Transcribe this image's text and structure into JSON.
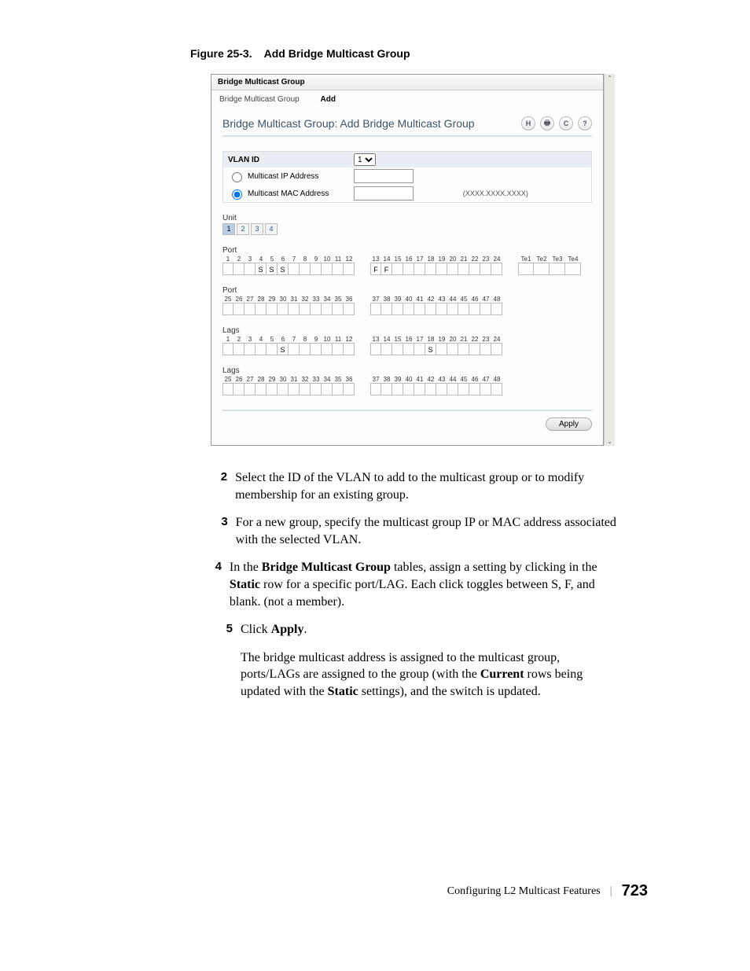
{
  "figure": {
    "label": "Figure 25-3.",
    "title": "Add Bridge Multicast Group"
  },
  "screenshot": {
    "topTab": "Bridge Multicast Group",
    "breadcrumb": {
      "a": "Bridge Multicast Group",
      "b": "Add"
    },
    "pageTitle": "Bridge Multicast Group: Add Bridge Multicast Group",
    "icons": {
      "save": "H",
      "print": "🖶",
      "refresh": "C",
      "help": "?"
    },
    "form": {
      "vlanLabel": "VLAN ID",
      "vlanValue": "1",
      "ipLabel": "Multicast IP Address",
      "macLabel": "Multicast MAC Address",
      "macHint": "(XXXX.XXXX.XXXX)"
    },
    "unit": {
      "label": "Unit",
      "items": [
        "1",
        "2",
        "3",
        "4"
      ]
    },
    "portLabel": "Port",
    "lagsLabel": "Lags",
    "portRow1a": [
      "1",
      "2",
      "3",
      "4",
      "5",
      "6",
      "7",
      "8",
      "9",
      "10",
      "11",
      "12"
    ],
    "portVals1a": [
      "",
      "",
      "",
      "S",
      "S",
      "S",
      "",
      "",
      "",
      "",
      "",
      ""
    ],
    "portRow1b": [
      "13",
      "14",
      "15",
      "16",
      "17",
      "18",
      "19",
      "20",
      "21",
      "22",
      "23",
      "24"
    ],
    "portVals1b": [
      "F",
      "F",
      "",
      "",
      "",
      "",
      "",
      "",
      "",
      "",
      "",
      ""
    ],
    "teHeader": [
      "Te1",
      "Te2",
      "Te3",
      "Te4"
    ],
    "teVals": [
      "",
      "",
      "",
      ""
    ],
    "portRow2a": [
      "25",
      "26",
      "27",
      "28",
      "29",
      "30",
      "31",
      "32",
      "33",
      "34",
      "35",
      "36"
    ],
    "portRow2b": [
      "37",
      "38",
      "39",
      "40",
      "41",
      "42",
      "43",
      "44",
      "45",
      "46",
      "47",
      "48"
    ],
    "lagRow1a": [
      "1",
      "2",
      "3",
      "4",
      "5",
      "6",
      "7",
      "8",
      "9",
      "10",
      "11",
      "12"
    ],
    "lagVals1a": [
      "",
      "",
      "",
      "",
      "",
      "S",
      "",
      "",
      "",
      "",
      "",
      ""
    ],
    "lagRow1b": [
      "13",
      "14",
      "15",
      "16",
      "17",
      "18",
      "19",
      "20",
      "21",
      "22",
      "23",
      "24"
    ],
    "lagVals1b": [
      "",
      "",
      "",
      "",
      "",
      "S",
      "",
      "",
      "",
      "",
      "",
      ""
    ],
    "lagRow2a": [
      "25",
      "26",
      "27",
      "28",
      "29",
      "30",
      "31",
      "32",
      "33",
      "34",
      "35",
      "36"
    ],
    "lagRow2b": [
      "37",
      "38",
      "39",
      "40",
      "41",
      "42",
      "43",
      "44",
      "45",
      "46",
      "47",
      "48"
    ],
    "applyLabel": "Apply"
  },
  "steps": {
    "s2": "Select the ID of the VLAN to add to the multicast group or to modify membership for an existing group.",
    "s3": "For a new group, specify the multicast group IP or MAC address associated with the selected VLAN.",
    "s4a": "In the ",
    "s4b": "Bridge Multicast Group",
    "s4c": " tables, assign a setting by clicking in the ",
    "s4d": "Static",
    "s4e": " row for a specific port/LAG. Each click toggles between S, F, and blank. (not a member).",
    "s5a": "Click ",
    "s5b": "Apply",
    "s5c": ".",
    "p1a": "The bridge multicast address is assigned to the multicast group, ports/LAGs are assigned to the group (with the ",
    "p1b": "Current",
    "p1c": " rows being updated with the ",
    "p1d": "Static",
    "p1e": " settings), and the switch is updated."
  },
  "footer": {
    "section": "Configuring L2 Multicast Features",
    "page": "723"
  }
}
